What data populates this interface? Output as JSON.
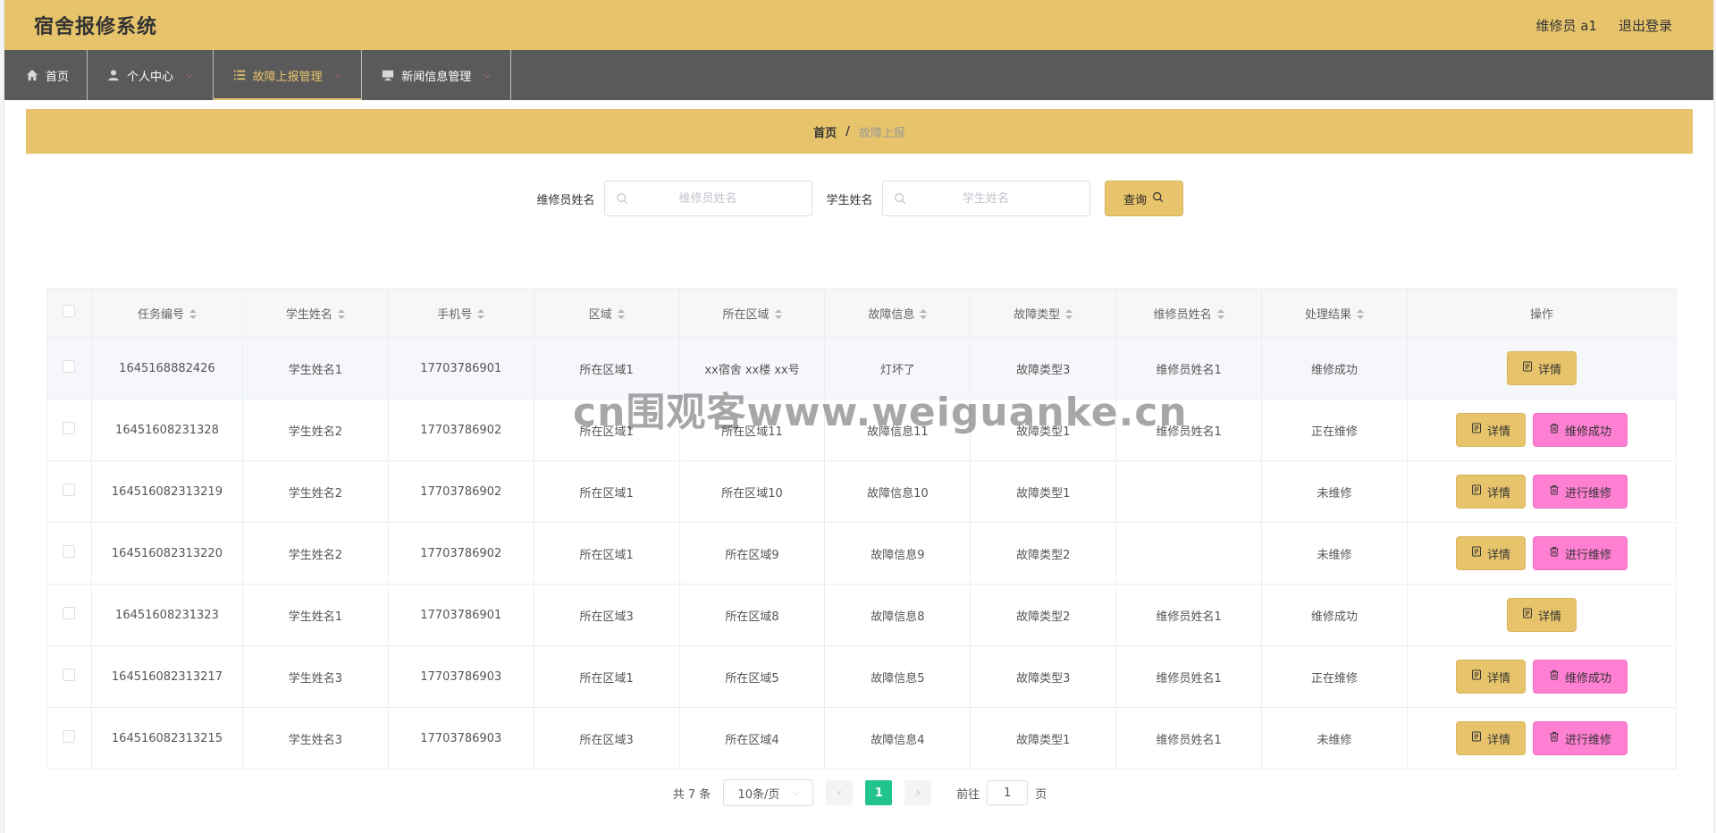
{
  "header": {
    "title": "宿舍报修系统",
    "user": "维修员 a1",
    "logout": "退出登录"
  },
  "nav": [
    {
      "label": "首页",
      "icon": "home-icon"
    },
    {
      "label": "个人中心",
      "icon": "user-icon"
    },
    {
      "label": "故障上报管理",
      "icon": "list-icon"
    },
    {
      "label": "新闻信息管理",
      "icon": "monitor-icon"
    }
  ],
  "breadcrumb": {
    "home": "首页",
    "sep": "/",
    "current": "故障上报"
  },
  "search": {
    "repairer_label": "维修员姓名",
    "repairer_placeholder": "维修员姓名",
    "student_label": "学生姓名",
    "student_placeholder": "学生姓名",
    "query_button": "查询"
  },
  "table": {
    "headers": [
      "任务编号",
      "学生姓名",
      "手机号",
      "区域",
      "所在区域",
      "故障信息",
      "故障类型",
      "维修员姓名",
      "处理结果",
      "操作"
    ],
    "rows": [
      {
        "id": "1645168882426",
        "student": "学生姓名1",
        "phone": "17703786901",
        "area": "所在区域1",
        "location": "xx宿舍 xx楼 xx号",
        "fault": "灯坏了",
        "type": "故障类型3",
        "repairer": "维修员姓名1",
        "result": "维修成功",
        "detail": "详情",
        "action": ""
      },
      {
        "id": "16451608231328",
        "student": "学生姓名2",
        "phone": "17703786902",
        "area": "所在区域1",
        "location": "所在区域11",
        "fault": "故障信息11",
        "type": "故障类型1",
        "repairer": "维修员姓名1",
        "result": "正在维修",
        "detail": "详情",
        "action": "维修成功"
      },
      {
        "id": "164516082313219",
        "student": "学生姓名2",
        "phone": "17703786902",
        "area": "所在区域1",
        "location": "所在区域10",
        "fault": "故障信息10",
        "type": "故障类型1",
        "repairer": "",
        "result": "未维修",
        "detail": "详情",
        "action": "进行维修"
      },
      {
        "id": "164516082313220",
        "student": "学生姓名2",
        "phone": "17703786902",
        "area": "所在区域1",
        "location": "所在区域9",
        "fault": "故障信息9",
        "type": "故障类型2",
        "repairer": "",
        "result": "未维修",
        "detail": "详情",
        "action": "进行维修"
      },
      {
        "id": "16451608231323",
        "student": "学生姓名1",
        "phone": "17703786901",
        "area": "所在区域3",
        "location": "所在区域8",
        "fault": "故障信息8",
        "type": "故障类型2",
        "repairer": "维修员姓名1",
        "result": "维修成功",
        "detail": "详情",
        "action": ""
      },
      {
        "id": "164516082313217",
        "student": "学生姓名3",
        "phone": "17703786903",
        "area": "所在区域1",
        "location": "所在区域5",
        "fault": "故障信息5",
        "type": "故障类型3",
        "repairer": "维修员姓名1",
        "result": "正在维修",
        "detail": "详情",
        "action": "维修成功"
      },
      {
        "id": "164516082313215",
        "student": "学生姓名3",
        "phone": "17703786903",
        "area": "所在区域3",
        "location": "所在区域4",
        "fault": "故障信息4",
        "type": "故障类型1",
        "repairer": "维修员姓名1",
        "result": "未维修",
        "detail": "详情",
        "action": "进行维修"
      }
    ]
  },
  "pagination": {
    "total": "共 7 条",
    "page_size": "10条/页",
    "current": "1",
    "goto_label": "前往",
    "goto_value": "1",
    "goto_suffix": "页"
  },
  "watermark": "cn围观客www.weiguanke.cn",
  "colors": {
    "accent": "#e7c46c",
    "nav": "#5a5a5a",
    "pink": "#ff7fd3",
    "page_active": "#21c48c"
  }
}
